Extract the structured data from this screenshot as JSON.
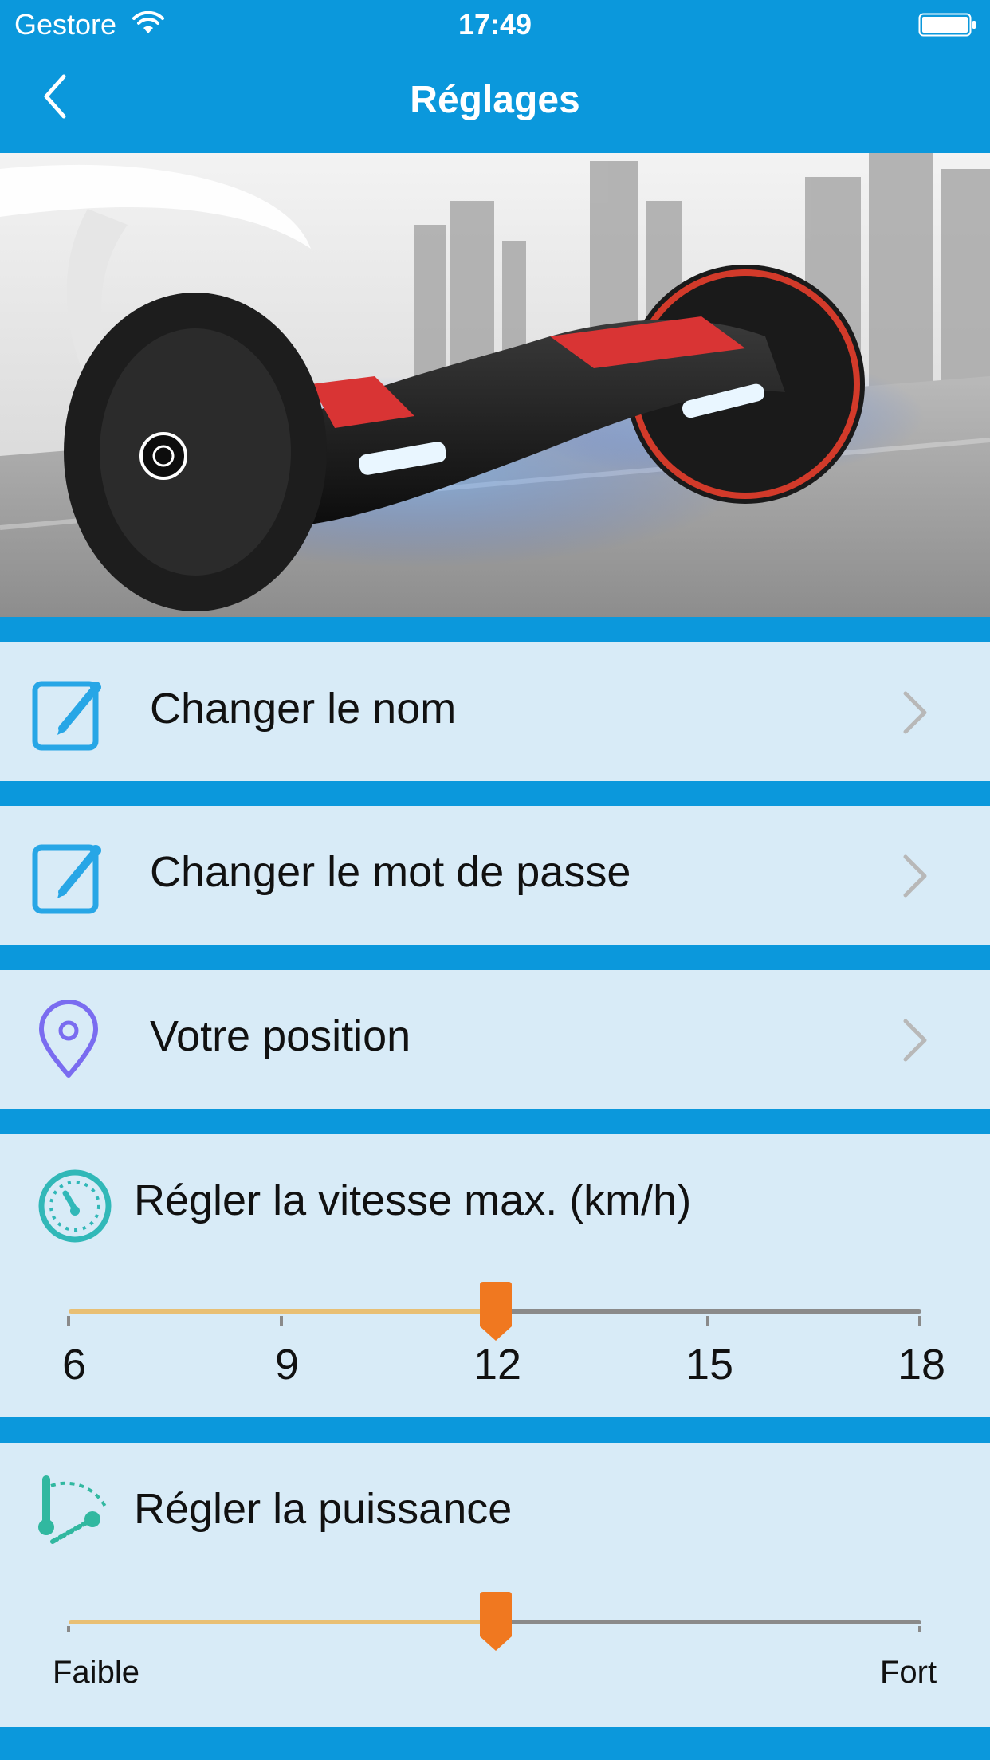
{
  "status_bar": {
    "carrier": "Gestore",
    "time": "17:49"
  },
  "nav": {
    "title": "Réglages",
    "back_icon": "chevron-left-icon"
  },
  "hero": {
    "alt": "hoverboard-photo"
  },
  "menu": {
    "items": [
      {
        "label": "Changer le nom",
        "icon": "edit-icon"
      },
      {
        "label": "Changer le mot de passe",
        "icon": "edit-icon"
      },
      {
        "label": "Votre position",
        "icon": "location-pin-icon"
      }
    ]
  },
  "speed": {
    "title": "Régler la vitesse max. (km/h)",
    "icon": "speedometer-icon",
    "ticks": [
      "6",
      "9",
      "12",
      "15",
      "18"
    ],
    "value": 12,
    "min": 6,
    "max": 18
  },
  "power": {
    "title": "Régler la puissance",
    "icon": "power-gauge-icon",
    "min_label": "Faible",
    "max_label": "Fort",
    "value_fraction": 0.5
  },
  "colors": {
    "header": "#0b98dc",
    "row_bg": "#d8ebf7",
    "track_fill": "#e8bf74",
    "track_rest": "#8a8a8a",
    "thumb": "#f07820",
    "icon_blue": "#27a6e6",
    "icon_purple": "#7a6cf0",
    "icon_teal": "#31b8b8"
  }
}
